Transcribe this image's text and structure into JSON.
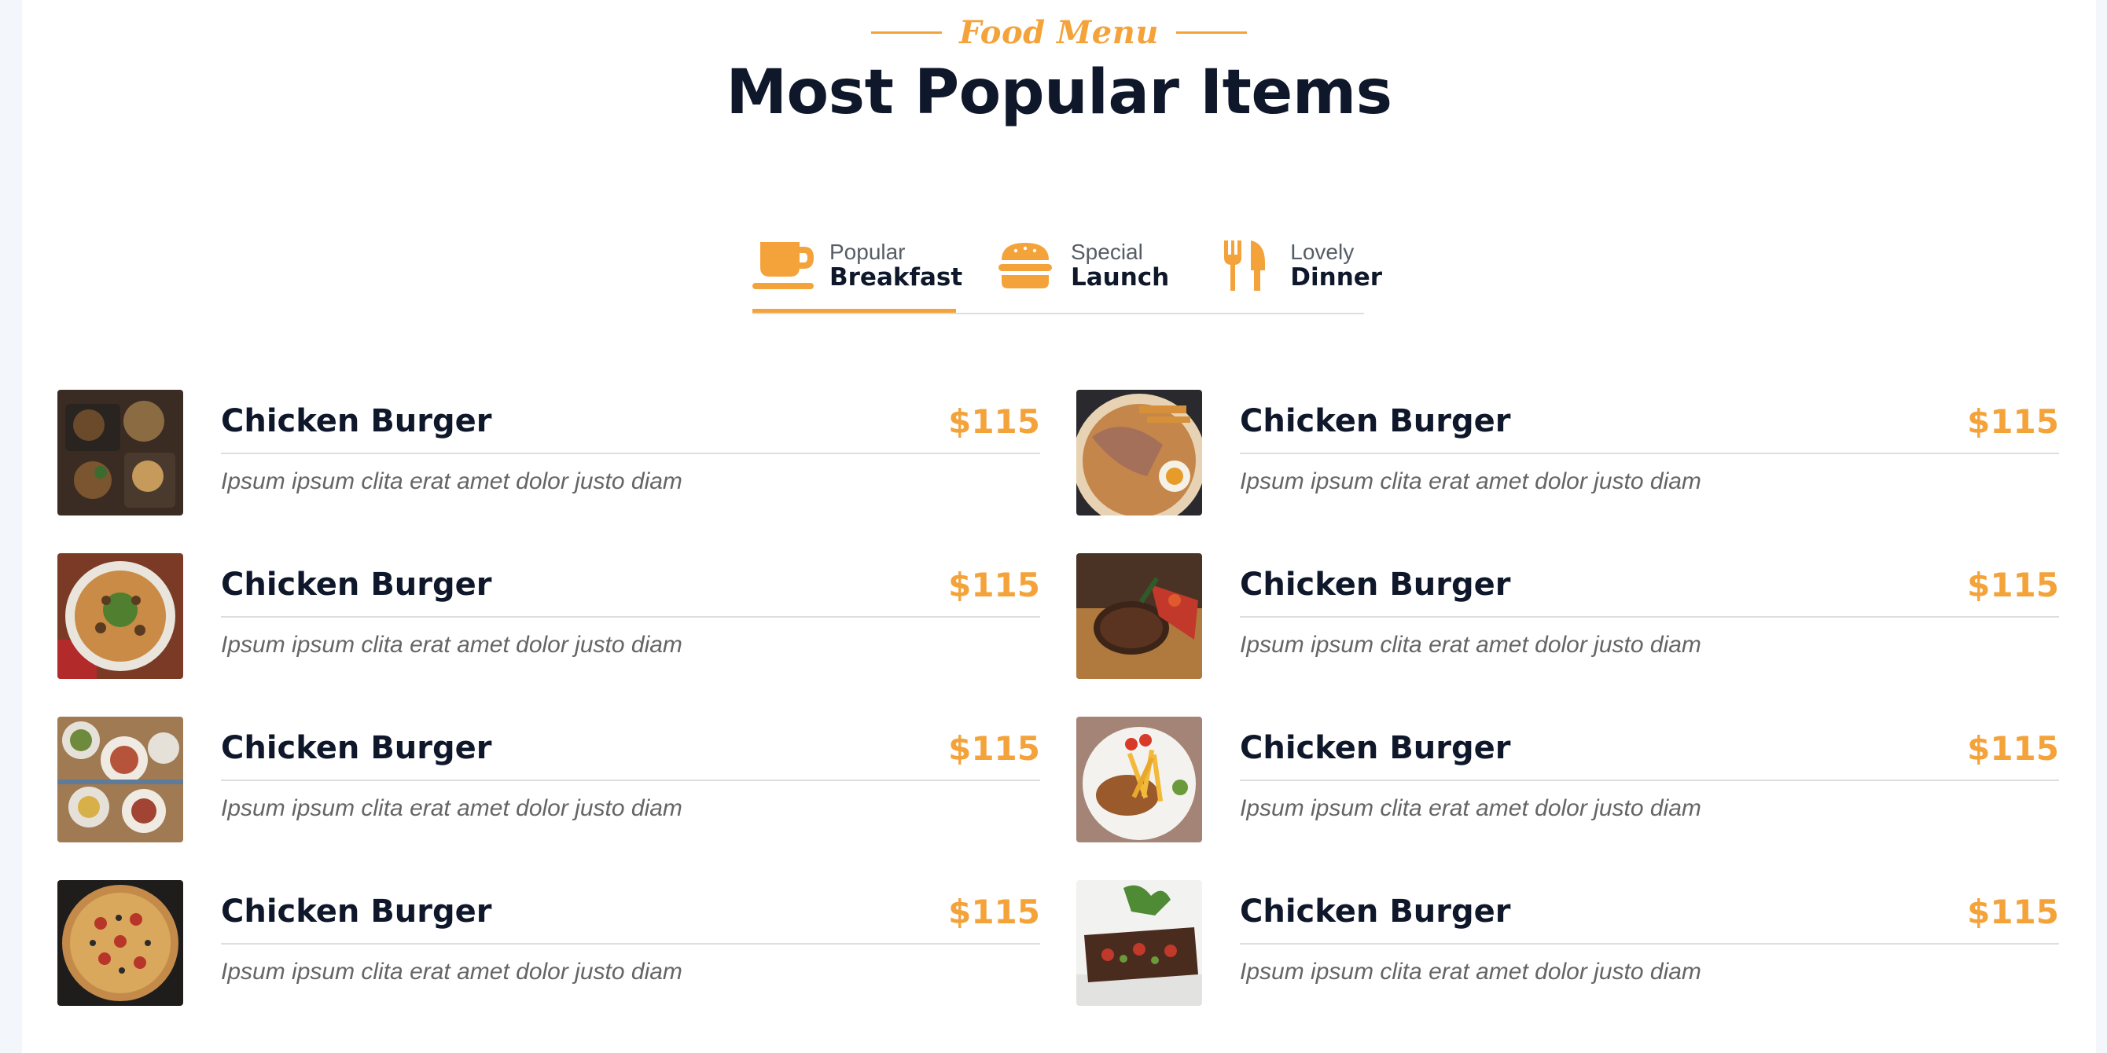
{
  "header": {
    "eyebrow": "Food Menu",
    "title": "Most Popular Items"
  },
  "tabs": [
    {
      "sub": "Popular",
      "main": "Breakfast",
      "icon": "coffee-cup-icon",
      "active": true
    },
    {
      "sub": "Special",
      "main": "Launch",
      "icon": "hamburger-icon",
      "active": false
    },
    {
      "sub": "Lovely",
      "main": "Dinner",
      "icon": "utensils-icon",
      "active": false
    }
  ],
  "menu": {
    "left": [
      {
        "name": "Chicken Burger",
        "price": "$115",
        "desc": "Ipsum ipsum clita erat amet dolor justo diam"
      },
      {
        "name": "Chicken Burger",
        "price": "$115",
        "desc": "Ipsum ipsum clita erat amet dolor justo diam"
      },
      {
        "name": "Chicken Burger",
        "price": "$115",
        "desc": "Ipsum ipsum clita erat amet dolor justo diam"
      },
      {
        "name": "Chicken Burger",
        "price": "$115",
        "desc": "Ipsum ipsum clita erat amet dolor justo diam"
      }
    ],
    "right": [
      {
        "name": "Chicken Burger",
        "price": "$115",
        "desc": "Ipsum ipsum clita erat amet dolor justo diam"
      },
      {
        "name": "Chicken Burger",
        "price": "$115",
        "desc": "Ipsum ipsum clita erat amet dolor justo diam"
      },
      {
        "name": "Chicken Burger",
        "price": "$115",
        "desc": "Ipsum ipsum clita erat amet dolor justo diam"
      },
      {
        "name": "Chicken Burger",
        "price": "$115",
        "desc": "Ipsum ipsum clita erat amet dolor justo diam"
      }
    ]
  },
  "colors": {
    "accent": "#f4a33b",
    "dark": "#0f172b",
    "muted": "#666565",
    "divider": "#dedede"
  }
}
